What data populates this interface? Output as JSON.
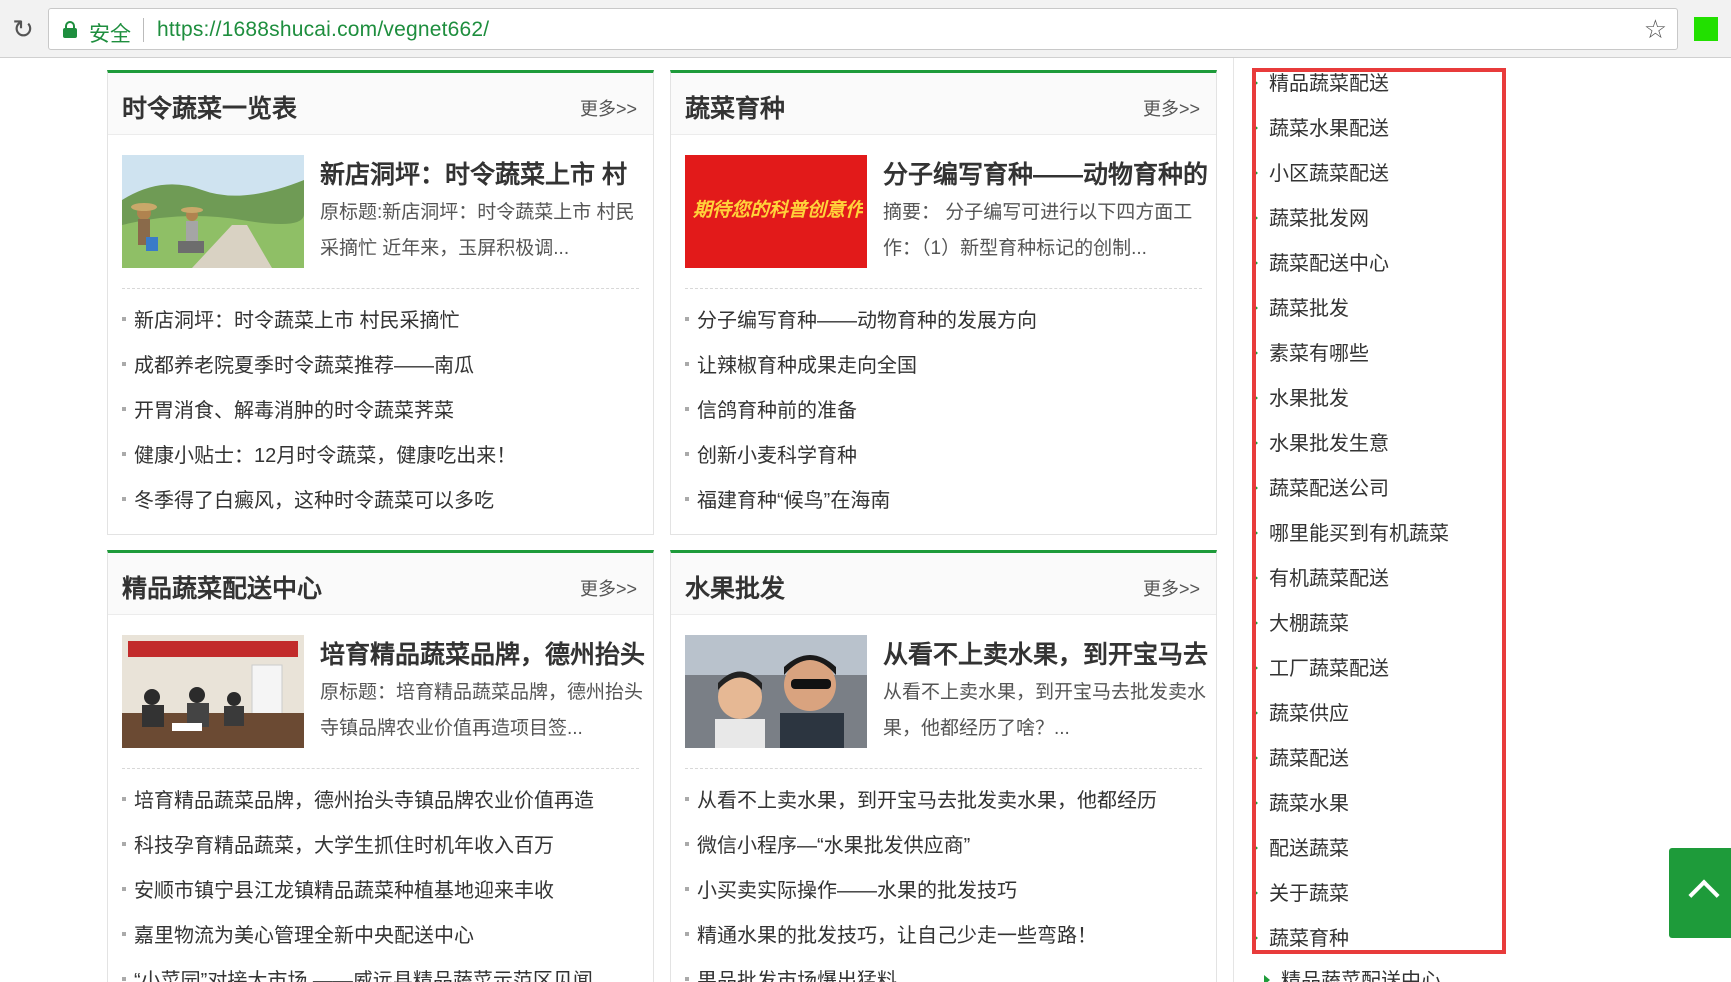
{
  "browser": {
    "secure_label": "安全",
    "url": "https://1688shucai.com/vegnet662/",
    "reload_icon": "reload-icon",
    "star_icon": "star-icon",
    "extension_color": "#22e000"
  },
  "theme": {
    "accent": "#1e9b3a",
    "highlight": "#e83b3b"
  },
  "panels": [
    {
      "title": "时令蔬菜一览表",
      "more": "更多>>",
      "feature": {
        "title": "新店洞坪：时令蔬菜上市 村",
        "desc": "原标题:新店洞坪：时令蔬菜上市 村民采摘忙 近年来，玉屏积极调..."
      },
      "items": [
        "新店洞坪：时令蔬菜上市 村民采摘忙",
        "成都养老院夏季时令蔬菜推荐——南瓜",
        "开胃消食、解毒消肿的时令蔬菜荠菜",
        "健康小贴士：12月时令蔬菜，健康吃出来！",
        "冬季得了白癜风，这种时令蔬菜可以多吃"
      ]
    },
    {
      "title": "蔬菜育种",
      "more": "更多>>",
      "feature": {
        "title": "分子编写育种——动物育种的",
        "desc": "摘要： 分子编写可进行以下四方面工作：（1）新型育种标记的创制...",
        "thumb_text": "期待您的科普创意作品"
      },
      "items": [
        "分子编写育种——动物育种的发展方向",
        "让辣椒育种成果走向全国",
        "信鸽育种前的准备",
        "创新小麦科学育种",
        "福建育种“候鸟”在海南"
      ]
    },
    {
      "title": "精品蔬菜配送中心",
      "more": "更多>>",
      "feature": {
        "title": "培育精品蔬菜品牌，德州抬头",
        "desc": "原标题：培育精品蔬菜品牌，德州抬头寺镇品牌农业价值再造项目签..."
      },
      "items": [
        "培育精品蔬菜品牌，德州抬头寺镇品牌农业价值再造",
        "科技孕育精品蔬菜，大学生抓住时机年收入百万",
        "安顺市镇宁县江龙镇精品蔬菜种植基地迎来丰收",
        "嘉里物流为美心管理全新中央配送中心",
        "“小菜园”对接大市场 ——威远县精品蔬菜示范区见闻"
      ]
    },
    {
      "title": "水果批发",
      "more": "更多>>",
      "feature": {
        "title": "从看不上卖水果，到开宝马去",
        "desc": "从看不上卖水果，到开宝马去批发卖水果，他都经历了啥？..."
      },
      "items": [
        "从看不上卖水果，到开宝马去批发卖水果，他都经历",
        "微信小程序—“水果批发供应商”",
        "小买卖实际操作——水果的批发技巧",
        "精通水果的批发技巧，让自己少走一些弯路！",
        "果品批发市场爆出猛料"
      ]
    }
  ],
  "sidebar": {
    "tags": [
      "精品蔬菜配送",
      "蔬菜水果配送",
      "小区蔬菜配送",
      "蔬菜批发网",
      "蔬菜配送中心",
      "蔬菜批发",
      "素菜有哪些",
      "水果批发",
      "水果批发生意",
      "蔬菜配送公司",
      "哪里能买到有机蔬菜",
      "有机蔬菜配送",
      "大棚蔬菜",
      "工厂蔬菜配送",
      "蔬菜供应",
      "蔬菜配送",
      "蔬菜水果",
      "配送蔬菜",
      "关于蔬菜",
      "蔬菜育种"
    ],
    "last_tag": "精品蔬菜配送中心"
  },
  "back_to_top_icon": "chevron-up-icon"
}
